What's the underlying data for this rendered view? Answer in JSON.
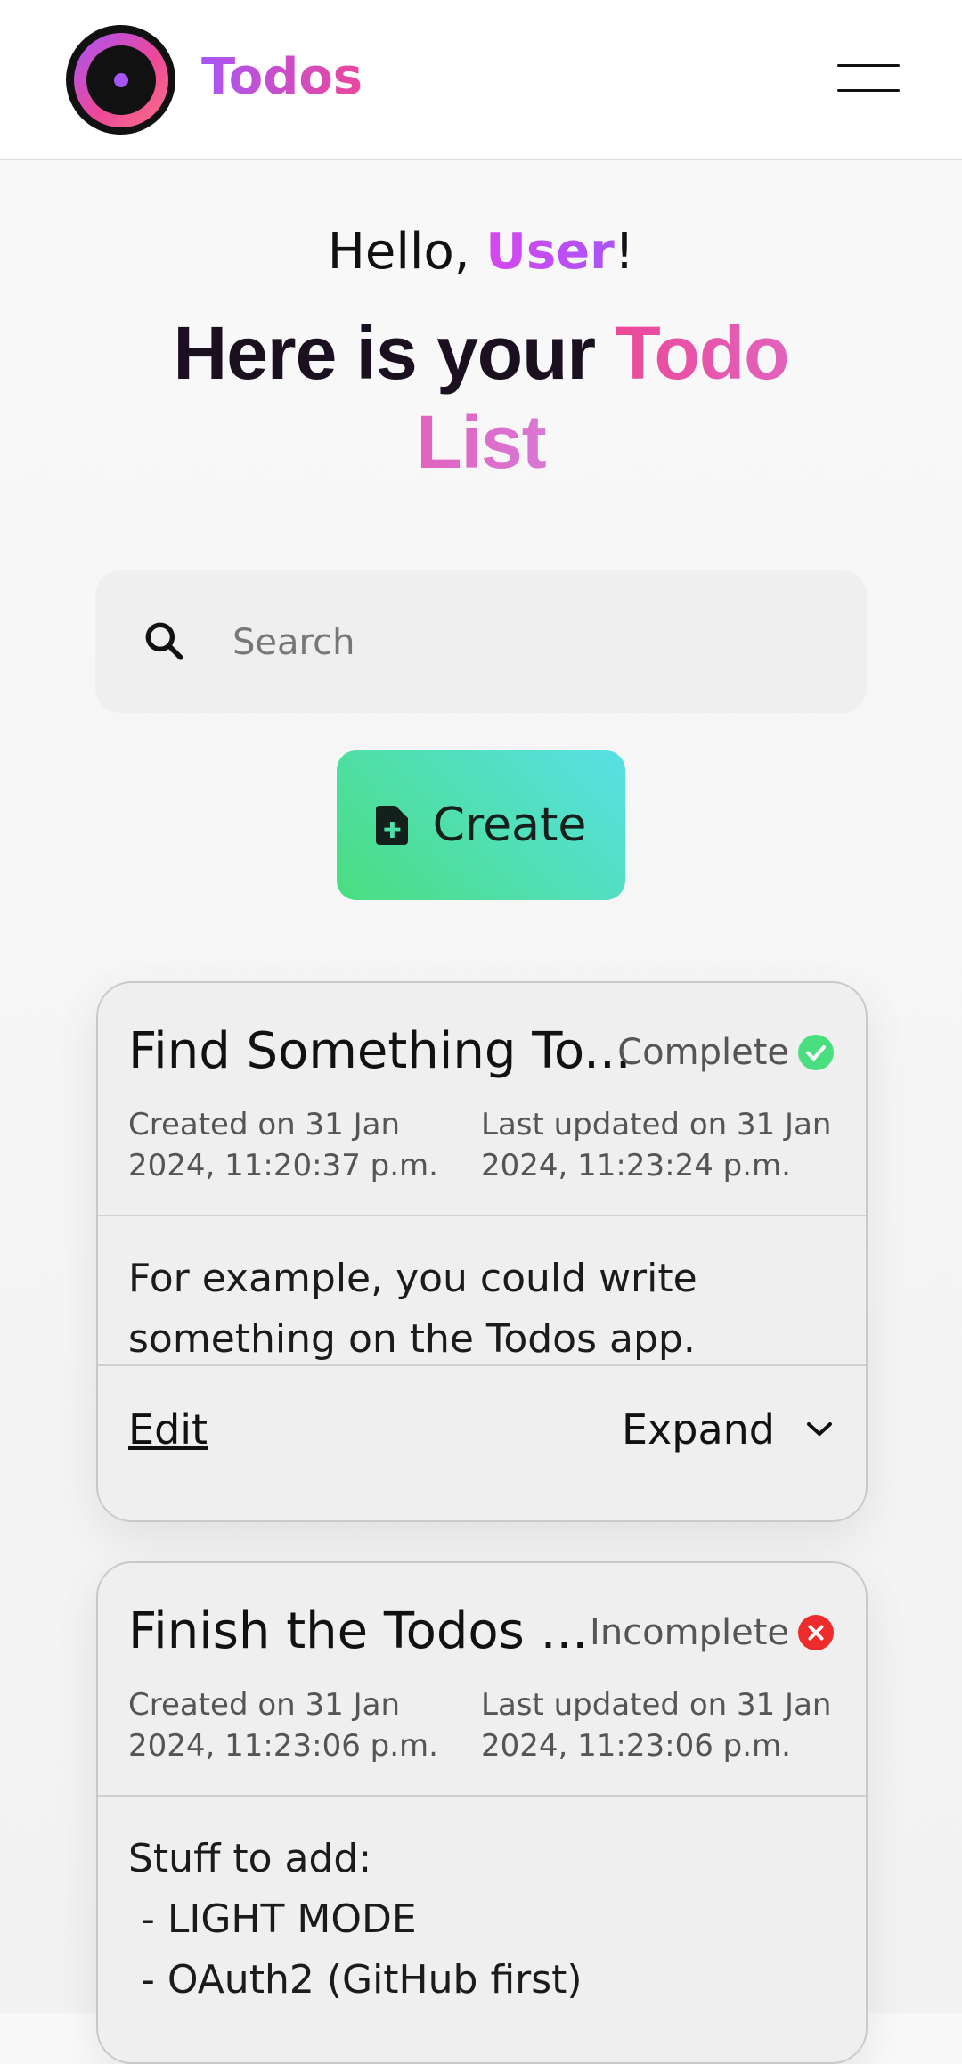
{
  "header": {
    "brand": "Todos",
    "logo_icon": "camera-lens-logo",
    "menu_icon": "hamburger-menu-icon"
  },
  "greeting": {
    "prefix": "Hello, ",
    "name": "User",
    "suffix": "!"
  },
  "heading": {
    "part1": "Here is your ",
    "part2": "Todo List"
  },
  "search": {
    "placeholder": "Search",
    "value": ""
  },
  "create": {
    "label": "Create",
    "icon": "file-plus-icon"
  },
  "todos": [
    {
      "title": "Find Something To...",
      "status": "Complete",
      "status_icon": "check-circle-icon",
      "created": "Created on 31 Jan 2024, 11:20:37 p.m.",
      "updated": "Last updated on 31 Jan 2024, 11:23:24 p.m.",
      "body": "For example, you could write something on the Todos app.",
      "edit_label": "Edit",
      "expand_label": "Expand"
    },
    {
      "title": "Finish the Todos ...",
      "status": "Incomplete",
      "status_icon": "x-circle-icon",
      "created": "Created on 31 Jan 2024, 11:23:06 p.m.",
      "updated": "Last updated on 31 Jan 2024, 11:23:06 p.m.",
      "body_lines": [
        "Stuff to add:",
        " - LIGHT MODE",
        " - OAuth2 (GitHub first)"
      ]
    }
  ],
  "colors": {
    "accent_purple": "#a855f7",
    "accent_pink": "#ec4899",
    "create_green": "#4ade80",
    "create_cyan": "#57e0e5",
    "complete": "#4ade80",
    "incomplete": "#ef2b2b"
  }
}
